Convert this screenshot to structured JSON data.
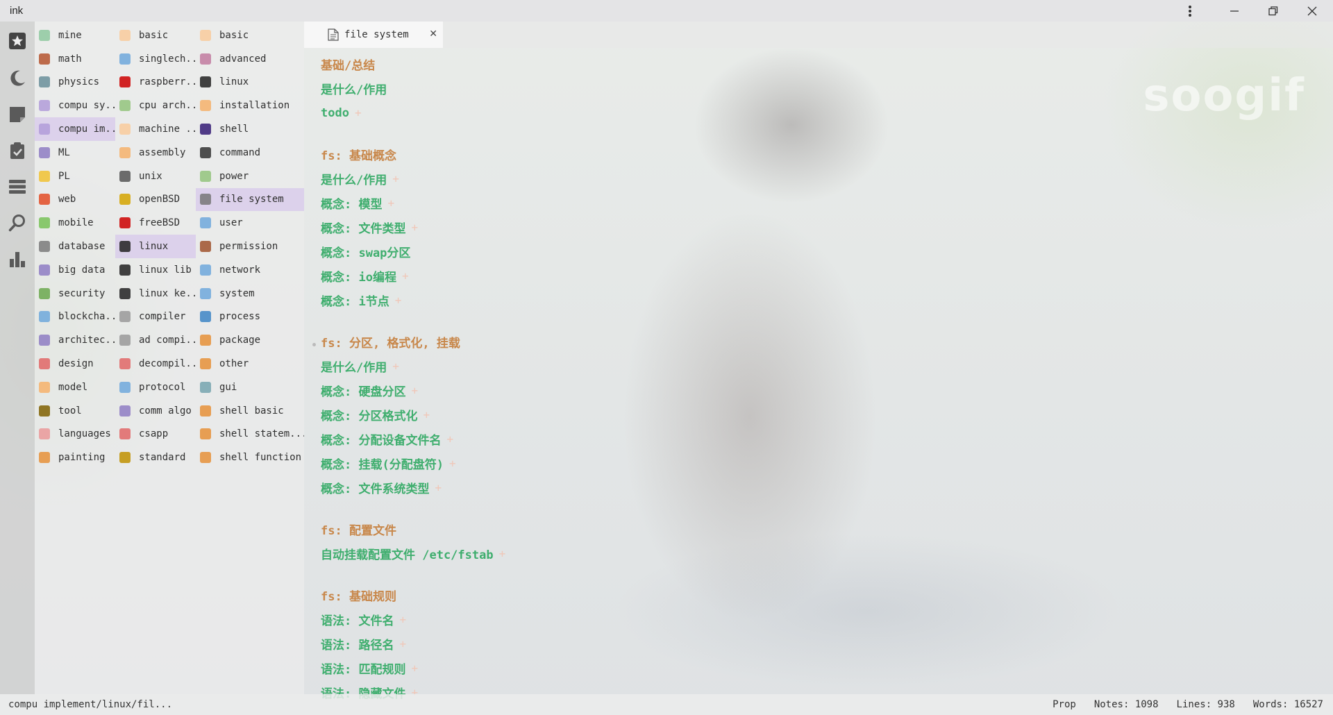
{
  "app": {
    "title": "ink"
  },
  "window_controls": [
    "more-vert-icon",
    "minimize-icon",
    "restore-icon",
    "close-icon"
  ],
  "activity_bar": [
    "star-icon",
    "moon-icon",
    "note-icon",
    "clipboard-icon",
    "stack-icon",
    "search-icon",
    "chart-icon"
  ],
  "tree": {
    "columns": [
      [
        {
          "label": "mine",
          "icon": "leaf-icon",
          "color": "#8fc9a0"
        },
        {
          "label": "math",
          "icon": "abacus-icon",
          "color": "#b5552f"
        },
        {
          "label": "physics",
          "icon": "physics-icon",
          "color": "#6a8f9a"
        },
        {
          "label": "compu sy...",
          "icon": "monitor-icon",
          "color": "#b19cd9"
        },
        {
          "label": "compu im...",
          "icon": "monitor-icon",
          "color": "#b19cd9",
          "selected": true
        },
        {
          "label": "ML",
          "icon": "ml-icon",
          "color": "#8e7cc3"
        },
        {
          "label": "PL",
          "icon": "js-icon",
          "color": "#f1c232"
        },
        {
          "label": "web",
          "icon": "html5-icon",
          "color": "#e34c26"
        },
        {
          "label": "mobile",
          "icon": "android-icon",
          "color": "#78c257"
        },
        {
          "label": "database",
          "icon": "database-icon",
          "color": "#7a7a7a"
        },
        {
          "label": "big data",
          "icon": "bigdata-icon",
          "color": "#8e7cc3"
        },
        {
          "label": "security",
          "icon": "shield-icon",
          "color": "#6aa84f"
        },
        {
          "label": "blockcha...",
          "icon": "blockchain-icon",
          "color": "#6fa8dc"
        },
        {
          "label": "architec...",
          "icon": "hierarchy-icon",
          "color": "#8e7cc3"
        },
        {
          "label": "design",
          "icon": "palette-icon",
          "color": "#e06666"
        },
        {
          "label": "model",
          "icon": "cube-icon",
          "color": "#f6b26b"
        },
        {
          "label": "tool",
          "icon": "hammer-icon",
          "color": "#7f6000"
        },
        {
          "label": "languages",
          "icon": "flower-icon",
          "color": "#ea9999"
        },
        {
          "label": "painting",
          "icon": "painting-icon",
          "color": "#e69138"
        }
      ],
      [
        {
          "label": "basic",
          "icon": "folder-icon",
          "color": "#f9cb9c"
        },
        {
          "label": "singlech...",
          "icon": "chip-icon",
          "color": "#6fa8dc"
        },
        {
          "label": "raspberr...",
          "icon": "raspberry-icon",
          "color": "#cc0000"
        },
        {
          "label": "cpu arch...",
          "icon": "cpu-icon",
          "color": "#93c47d"
        },
        {
          "label": "machine ...",
          "icon": "folder-icon",
          "color": "#f9cb9c"
        },
        {
          "label": "assembly",
          "icon": "assembly-icon",
          "color": "#f6b26b"
        },
        {
          "label": "unix",
          "icon": "unix-icon",
          "color": "#555555"
        },
        {
          "label": "openBSD",
          "icon": "openbsd-icon",
          "color": "#d5a500"
        },
        {
          "label": "freeBSD",
          "icon": "freebsd-icon",
          "color": "#cc0000"
        },
        {
          "label": "linux",
          "icon": "tux-icon",
          "color": "#222222",
          "selected": true
        },
        {
          "label": "linux lib",
          "icon": "tux-icon",
          "color": "#222222"
        },
        {
          "label": "linux ke...",
          "icon": "tux-icon",
          "color": "#222222"
        },
        {
          "label": "compiler",
          "icon": "compiler-icon",
          "color": "#999999"
        },
        {
          "label": "ad compi...",
          "icon": "compiler-icon",
          "color": "#999999"
        },
        {
          "label": "decompil...",
          "icon": "decompiler-icon",
          "color": "#e06666"
        },
        {
          "label": "protocol",
          "icon": "globe-icon",
          "color": "#6fa8dc"
        },
        {
          "label": "comm algo",
          "icon": "gear-icon",
          "color": "#8e7cc3"
        },
        {
          "label": "csapp",
          "icon": "csapp-icon",
          "color": "#e06666"
        },
        {
          "label": "standard",
          "icon": "book-icon",
          "color": "#bf9000"
        }
      ],
      [
        {
          "label": "basic",
          "icon": "folder-icon",
          "color": "#f9cb9c"
        },
        {
          "label": "advanced",
          "icon": "diamond-icon",
          "color": "#c27ba0"
        },
        {
          "label": "linux",
          "icon": "tux-icon",
          "color": "#222222"
        },
        {
          "label": "installation",
          "icon": "installation-icon",
          "color": "#f6b26b"
        },
        {
          "label": "shell",
          "icon": "terminal-icon",
          "color": "#351c75"
        },
        {
          "label": "command",
          "icon": "console-icon",
          "color": "#333333"
        },
        {
          "label": "power",
          "icon": "power-icon",
          "color": "#93c47d"
        },
        {
          "label": "file system",
          "icon": "file-icon",
          "color": "#777777",
          "selected": true
        },
        {
          "label": "user",
          "icon": "user-icon",
          "color": "#6fa8dc"
        },
        {
          "label": "permission",
          "icon": "lock-icon",
          "color": "#a0522d"
        },
        {
          "label": "network",
          "icon": "globe-icon",
          "color": "#6fa8dc"
        },
        {
          "label": "system",
          "icon": "window-icon",
          "color": "#6fa8dc"
        },
        {
          "label": "process",
          "icon": "sliders-icon",
          "color": "#3d85c6"
        },
        {
          "label": "package",
          "icon": "package-icon",
          "color": "#e69138"
        },
        {
          "label": "other",
          "icon": "notebook-icon",
          "color": "#e69138"
        },
        {
          "label": "gui",
          "icon": "gui-icon",
          "color": "#76a5af"
        },
        {
          "label": "shell basic",
          "icon": "notebook-icon",
          "color": "#e69138"
        },
        {
          "label": "shell statem...",
          "icon": "notebook-icon",
          "color": "#e69138"
        },
        {
          "label": "shell function",
          "icon": "notebook-icon",
          "color": "#e69138"
        }
      ]
    ]
  },
  "tab": {
    "label": "file system",
    "icon": "file-icon"
  },
  "outline": [
    {
      "type": "h",
      "text": "基础/总结"
    },
    {
      "type": "i",
      "text": "是什么/作用"
    },
    {
      "type": "i",
      "text": "todo",
      "plus": "+"
    },
    {
      "type": "gap"
    },
    {
      "type": "h",
      "text": "fs: 基础概念"
    },
    {
      "type": "i",
      "text": "是什么/作用",
      "plus": "+"
    },
    {
      "type": "i",
      "text": "概念: 模型",
      "plus": "+"
    },
    {
      "type": "i",
      "text": "概念: 文件类型",
      "plus": "+"
    },
    {
      "type": "i",
      "text": "概念: swap分区"
    },
    {
      "type": "i",
      "text": "概念: io编程",
      "plus": "+"
    },
    {
      "type": "i",
      "text": "概念: i节点",
      "plus": "+"
    },
    {
      "type": "gap"
    },
    {
      "type": "h",
      "text": "fs: 分区, 格式化, 挂载"
    },
    {
      "type": "i",
      "text": "是什么/作用",
      "plus": "+"
    },
    {
      "type": "i",
      "text": "概念: 硬盘分区",
      "plus": "+"
    },
    {
      "type": "i",
      "text": "概念: 分区格式化",
      "plus": "+"
    },
    {
      "type": "i",
      "text": "概念: 分配设备文件名",
      "plus": "+"
    },
    {
      "type": "i",
      "text": "概念: 挂载(分配盘符)",
      "plus": "+"
    },
    {
      "type": "i",
      "text": "概念: 文件系统类型",
      "plus": "+"
    },
    {
      "type": "gap"
    },
    {
      "type": "h",
      "text": "fs: 配置文件"
    },
    {
      "type": "i",
      "text": "自动挂载配置文件 /etc/fstab",
      "plus": "+"
    },
    {
      "type": "gap"
    },
    {
      "type": "h",
      "text": "fs: 基础规则"
    },
    {
      "type": "i",
      "text": "语法: 文件名",
      "plus": "+"
    },
    {
      "type": "i",
      "text": "语法: 路径名",
      "plus": "+"
    },
    {
      "type": "i",
      "text": "语法: 匹配规则",
      "plus": "+"
    },
    {
      "type": "i",
      "text": "语法: 隐藏文件",
      "plus": "+"
    }
  ],
  "watermark": "soogif",
  "status": {
    "path": "compu implement/linux/fil...",
    "mode": "Prop",
    "notes": "Notes: 1098",
    "lines": "Lines: 938",
    "words": "Words: 16527"
  }
}
